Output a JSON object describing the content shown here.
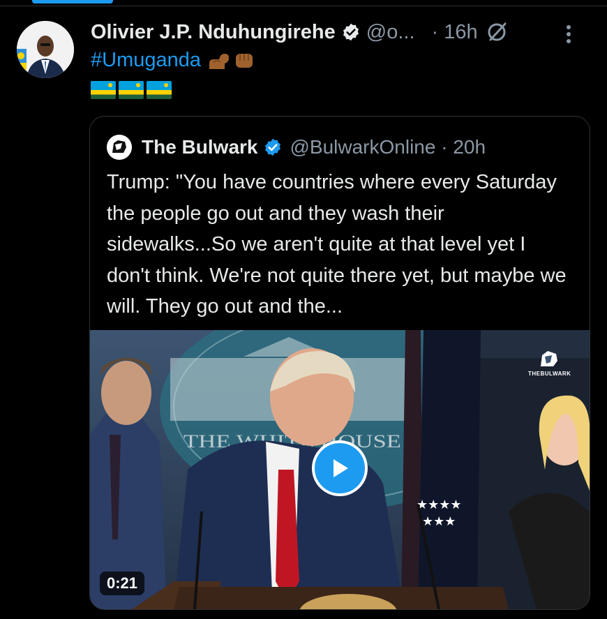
{
  "tweet": {
    "author_name": "Olivier J.P. Nduhungirehe",
    "author_handle": "@o...",
    "separator": "·",
    "time": "16h",
    "text": "#Umuganda",
    "emojis": [
      "flexed-biceps",
      "raised-fist"
    ],
    "flag_count": 3
  },
  "quote": {
    "author_name": "The Bulwark",
    "author_handle": "@BulwarkOnline · 20h",
    "text": "Trump: \"You have countries where every Saturday the people go out and they wash their sidewalks...So we aren't quite at that level yet I don't think. We're not quite there yet, but maybe we will. They go out and the...",
    "video": {
      "duration": "0:21",
      "watermark": "THEBULWARK",
      "background_sign_text": "THE WHITE HOUSE"
    }
  },
  "colors": {
    "accent": "#1d9bf0",
    "background": "#000000",
    "text_primary": "#e7e9ea",
    "text_secondary": "#8b98a5"
  },
  "icons": [
    "verified-badge-icon",
    "grok-icon",
    "more-icon",
    "play-icon",
    "flexed-biceps-emoji",
    "raised-fist-emoji",
    "rwanda-flag-emoji"
  ]
}
